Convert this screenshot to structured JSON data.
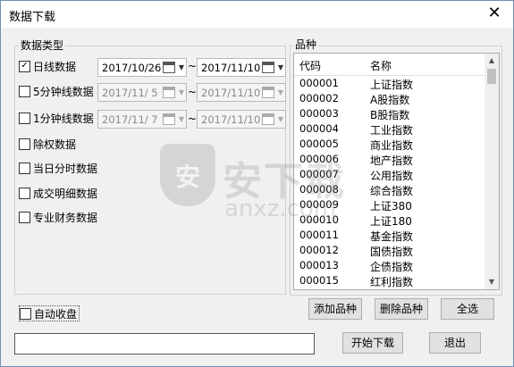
{
  "window": {
    "title": "数据下载",
    "close_glyph": "✕"
  },
  "data_type": {
    "label": "数据类型",
    "options": [
      {
        "label": "日线数据",
        "checked": true,
        "from": "2017/10/26",
        "to": "2017/11/10",
        "dates_enabled": true
      },
      {
        "label": "5分钟线数据",
        "checked": false,
        "from": "2017/11/ 5",
        "to": "2017/11/10",
        "dates_enabled": false
      },
      {
        "label": "1分钟线数据",
        "checked": false,
        "from": "2017/11/ 7",
        "to": "2017/11/10",
        "dates_enabled": false
      },
      {
        "label": "除权数据",
        "checked": false
      },
      {
        "label": "当日分时数据",
        "checked": false
      },
      {
        "label": "成交明细数据",
        "checked": false
      },
      {
        "label": "专业财务数据",
        "checked": false
      }
    ],
    "range_sep": "~"
  },
  "auto_close": {
    "label": "自动收盘",
    "checked": false
  },
  "products": {
    "label": "品种",
    "columns": [
      "代码",
      "名称"
    ],
    "rows": [
      {
        "code": "000001",
        "name": "上证指数"
      },
      {
        "code": "000002",
        "name": "A股指数"
      },
      {
        "code": "000003",
        "name": "B股指数"
      },
      {
        "code": "000004",
        "name": "工业指数"
      },
      {
        "code": "000005",
        "name": "商业指数"
      },
      {
        "code": "000006",
        "name": "地产指数"
      },
      {
        "code": "000007",
        "name": "公用指数"
      },
      {
        "code": "000008",
        "name": "综合指数"
      },
      {
        "code": "000009",
        "name": "上证380"
      },
      {
        "code": "000010",
        "name": "上证180"
      },
      {
        "code": "000011",
        "name": "基金指数"
      },
      {
        "code": "000012",
        "name": "国债指数"
      },
      {
        "code": "000013",
        "name": "企债指数"
      },
      {
        "code": "000015",
        "name": "红利指数"
      }
    ]
  },
  "buttons": {
    "add": "添加品种",
    "delete": "删除品种",
    "select_all": "全选",
    "start": "开始下载",
    "exit": "退出"
  },
  "watermark": {
    "main": "安下载",
    "sub": "anxz.com",
    "shield": "安"
  },
  "icons": {
    "check": "✓",
    "calendar": "calendar-icon",
    "dropdown": "▼",
    "up": "▲",
    "down": "▼"
  }
}
